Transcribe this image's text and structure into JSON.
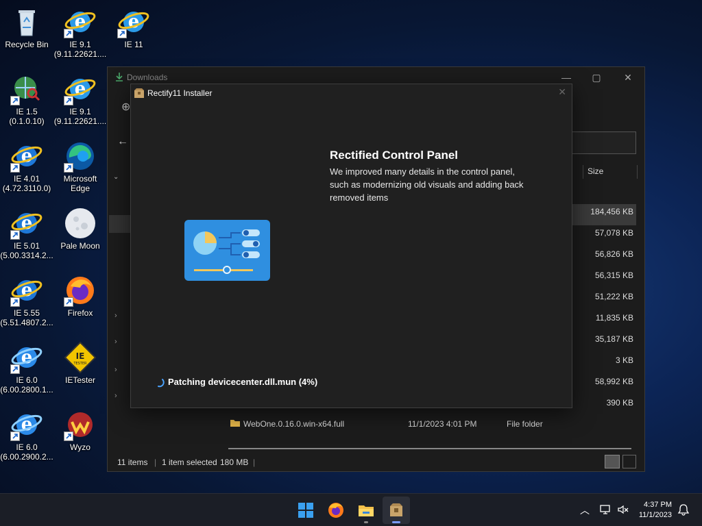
{
  "desktop": {
    "icons": [
      {
        "label": "Recycle Bin",
        "icon": "recycle-bin-icon"
      },
      {
        "label": "IE 9.1\n(9.11.22621....",
        "icon": "ie-icon"
      },
      {
        "label": "IE 11",
        "icon": "ie-icon"
      },
      {
        "label": "IE 1.5\n(0.1.0.10)",
        "icon": "ie-globe-icon"
      },
      {
        "label": "IE 9.1\n(9.11.22621....",
        "icon": "ie-icon"
      },
      {
        "label": "IE 4.01\n(4.72.3110.0)",
        "icon": "ie-icon"
      },
      {
        "label": "Microsoft\nEdge",
        "icon": "edge-icon"
      },
      {
        "label": "IE 5.01\n(5.00.3314.2...",
        "icon": "ie-icon"
      },
      {
        "label": "Pale Moon",
        "icon": "pale-moon-icon"
      },
      {
        "label": "IE 5.55\n(5.51.4807.2...",
        "icon": "ie-icon"
      },
      {
        "label": "Firefox",
        "icon": "firefox-icon"
      },
      {
        "label": "IE 6.0\n(6.00.2800.1...",
        "icon": "ie-icon"
      },
      {
        "label": "IETester",
        "icon": "ietester-icon"
      },
      {
        "label": "IE 6.0\n(6.00.2900.2...",
        "icon": "ie-icon"
      },
      {
        "label": "Wyzo",
        "icon": "wyzo-icon"
      }
    ]
  },
  "explorer": {
    "title": "Downloads",
    "size_header": "Size",
    "sizes": [
      "184,456 KB",
      "57,078 KB",
      "56,826 KB",
      "56,315 KB",
      "51,222 KB",
      "11,835 KB",
      "35,187 KB",
      "3 KB",
      "58,992 KB",
      "390 KB"
    ],
    "last_row": {
      "name": "WebOne.0.16.0.win-x64.full",
      "date": "11/1/2023 4:01 PM",
      "type": "File folder"
    },
    "status": {
      "items": "11 items",
      "selected": "1 item selected",
      "size": "180 MB"
    }
  },
  "installer": {
    "title": "Rectify11 Installer",
    "heading": "Rectified Control Panel",
    "description": "We improved many details in the control panel, such as modernizing old visuals and adding back removed items",
    "progress_text": "Patching devicecenter.dll.mun (4%)",
    "progress_percent": 4
  },
  "taskbar": {
    "apps": [
      "start-icon",
      "firefox-icon",
      "file-explorer-icon",
      "installer-icon"
    ],
    "time": "4:37 PM",
    "date": "11/1/2023"
  },
  "colors": {
    "accent": "#7a9cff",
    "installer_bg": "#202020",
    "explorer_bg": "#1c1c1c"
  }
}
